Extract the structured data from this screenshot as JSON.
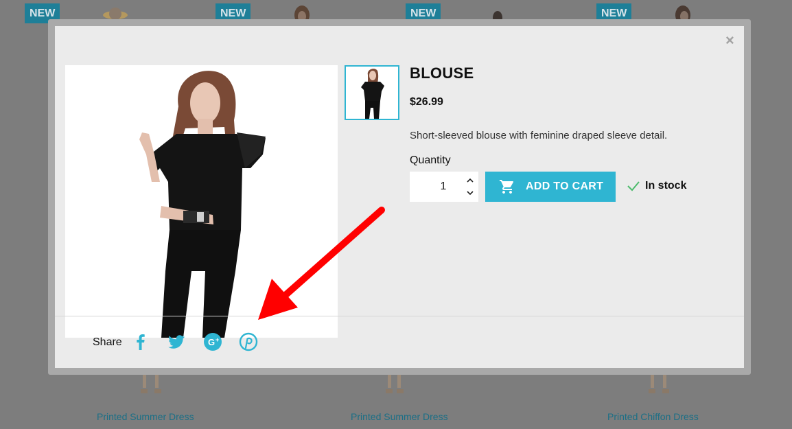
{
  "background": {
    "badges": [
      "NEW",
      "NEW",
      "NEW",
      "NEW"
    ],
    "products": [
      "Printed Summer Dress",
      "Printed Summer Dress",
      "Printed Chiffon Dress"
    ]
  },
  "modal": {
    "close_label": "×",
    "title": "BLOUSE",
    "price": "$26.99",
    "description": "Short-sleeved blouse with feminine draped sleeve detail.",
    "quantity_label": "Quantity",
    "quantity_value": "1",
    "add_to_cart_label": "ADD TO CART",
    "stock_status": "In stock",
    "share_label": "Share"
  },
  "icons": {
    "share": [
      "facebook-icon",
      "twitter-icon",
      "google-plus-icon",
      "pinterest-icon"
    ],
    "cart": "cart-icon",
    "stock": "checkmark-icon",
    "annotation": "red-arrow"
  },
  "colors": {
    "accent": "#2fb5d2",
    "overlay": "#7d7d7d",
    "badge": "#1e7f98",
    "stock_check": "#4cbb6c",
    "annotation": "#ff0000"
  }
}
